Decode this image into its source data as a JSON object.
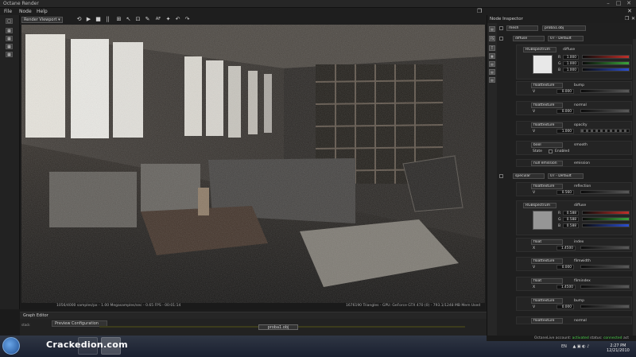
{
  "window": {
    "title": "Octane Render"
  },
  "menu": [
    "File",
    "Node",
    "Help"
  ],
  "left_tools": [
    "□",
    "▦",
    "▦",
    "▦",
    "▦"
  ],
  "viewport": {
    "selector": "Render Viewport",
    "toolbar_icons": [
      "⟲",
      "▶",
      "■",
      "||",
      "⊞",
      "↖",
      "⊡",
      "✎",
      "AF",
      "✦",
      "↶",
      "↷"
    ],
    "status_left": "1056/4000 samples/px - 1.00 Megasamples/sec - 0.65 FPS - 00:01:14",
    "status_right": "1676190 Triangles - GPU: GeForce GTX 470 (0) - 793.1/1248 MB Mem Used"
  },
  "graph_editor": {
    "title": "Graph Editor",
    "node_label": "Preview Configuration",
    "mesh_label": "proba1.obj",
    "side_label": "stack"
  },
  "inspector": {
    "title": "Node Inspector",
    "side_icons": [
      "▤",
      "FS",
      "T",
      "▦",
      "▤",
      "▤",
      "▤"
    ],
    "mesh_row": {
      "type": "mesh",
      "value": "proba1.obj"
    },
    "diffuse_section": {
      "type": "diffuse",
      "value": "07 - Default"
    },
    "rgb1": {
      "type": "RGBspectrum",
      "name": "diffuse",
      "r": "1.000",
      "g": "1.000",
      "b": "1.000"
    },
    "bump1": {
      "type": "floattexture",
      "name": "bump",
      "value": "0.000"
    },
    "normal1": {
      "type": "floattexture",
      "name": "normal",
      "value": "0.000"
    },
    "opacity1": {
      "type": "floattexture",
      "name": "opacity",
      "value": "1.000"
    },
    "smooth": {
      "type": "bool",
      "name": "smooth",
      "state_label": "State",
      "state_value": "Enabled"
    },
    "emission": {
      "type": "null emission",
      "name": "emission"
    },
    "specular_section": {
      "type": "specular",
      "value": "07 - Default"
    },
    "reflection": {
      "type": "floattexture",
      "name": "reflection",
      "value": "0.560"
    },
    "rgb2": {
      "type": "RGBspectrum",
      "name": "diffuse",
      "r": "0.588",
      "g": "0.588",
      "b": "0.588"
    },
    "index": {
      "type": "float",
      "name": "index",
      "value": "1.4500"
    },
    "filmwidth": {
      "type": "floattexture",
      "name": "filmwidth",
      "value": "0.000"
    },
    "filmindex": {
      "type": "float",
      "name": "filmindex",
      "value": "1.4500"
    },
    "bump2": {
      "type": "floattexture",
      "name": "bump",
      "value": "0.000"
    },
    "normal2": {
      "type": "floattexture",
      "name": "normal"
    }
  },
  "octanelive": {
    "account_label": "OctaneLive account:",
    "account_value": "activated",
    "status_label": "status:",
    "status_value": "connected",
    "extra": "act"
  },
  "taskbar": {
    "watermark": "Crackedion.com",
    "lang": "EN",
    "time": "2:27 PM",
    "date": "12/21/2010"
  },
  "colors": {
    "accent_red": "#c0302a",
    "accent_green": "#3aa33a",
    "accent_blue": "#2c4fd0",
    "connected_green": "#4cd04c"
  }
}
